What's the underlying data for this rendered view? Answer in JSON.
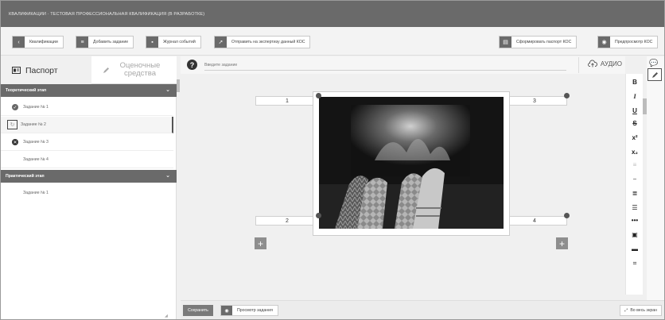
{
  "title": "КВАЛИФИКАЦИИ · ТЕСТОВАЯ ПРОФЕССИОНАЛЬНАЯ КВАЛИФИКАЦИЯ (В РАЗРАБОТКЕ)",
  "toolbar": {
    "back_label": "Квалификации",
    "add_task_label": "Добавить задание",
    "log_label": "Журнал событий",
    "send_label": "Отправить на экспертизу данный КОС",
    "passport_label": "Сформировать паспорт КОС",
    "preview_kos_label": "Предпросмотр КОС"
  },
  "tabs": {
    "passport": "Паспорт",
    "assessment": "Оценочные средства"
  },
  "sections": [
    {
      "title": "Теоретический этап",
      "tasks": [
        {
          "label": "Задание № 1",
          "status": "done"
        },
        {
          "label": "Задание № 2",
          "status": "in-progress"
        },
        {
          "label": "Задание № 3",
          "status": "error"
        },
        {
          "label": "Задание № 4",
          "status": "none"
        }
      ]
    },
    {
      "title": "Практический этап",
      "tasks": [
        {
          "label": "Задание № 1",
          "status": "none"
        }
      ]
    }
  ],
  "editor": {
    "question_placeholder": "Введите задание",
    "audio_label": "АУДИО",
    "cards": [
      "1",
      "2",
      "3",
      "4"
    ],
    "format_buttons": [
      "B",
      "I",
      "U",
      "S",
      "x²",
      "x₂",
      "align",
      "hr",
      "list-ol",
      "list-ul",
      "more",
      "comment",
      "image",
      "crop"
    ]
  },
  "bottom": {
    "save_label": "Сохранить",
    "preview_label": "Просмотр задания",
    "fullscreen_label": "Во весь экран"
  },
  "colors": {
    "header_bg": "#6a6a6a",
    "accent_dark": "#333333",
    "panel_bg": "#f0f0f0"
  }
}
